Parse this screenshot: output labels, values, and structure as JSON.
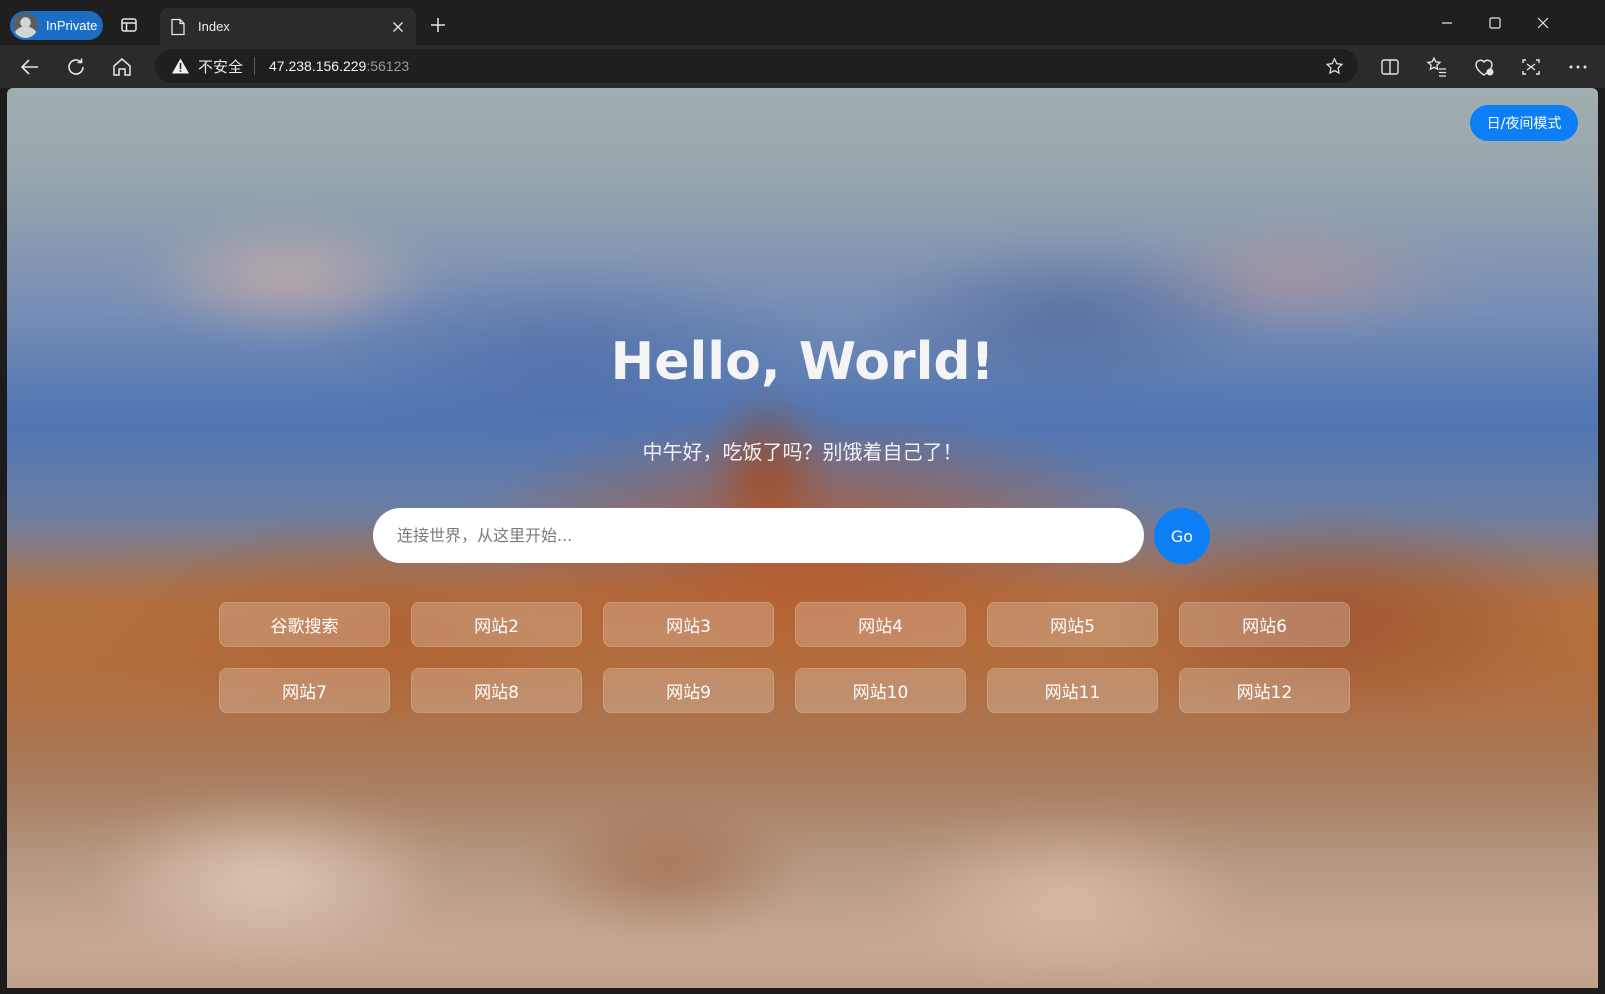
{
  "browser": {
    "profile_label": "InPrivate",
    "tab_title": "Index",
    "address_insecure": "不安全",
    "address_host": "47.238.156.229",
    "address_port": ":56123"
  },
  "page": {
    "theme_toggle_label": "日/夜间模式",
    "title": "Hello, World!",
    "greeting": "中午好，吃饭了吗？别饿着自己了！",
    "search_placeholder": "连接世界，从这里开始...",
    "go_label": "Go",
    "links": [
      "谷歌搜索",
      "网站2",
      "网站3",
      "网站4",
      "网站5",
      "网站6",
      "网站7",
      "网站8",
      "网站9",
      "网站10",
      "网站11",
      "网站12"
    ]
  },
  "colors": {
    "accent": "#0d7ff6",
    "titlebar": "#1f1f1f",
    "toolbar": "#2b2b2b"
  }
}
